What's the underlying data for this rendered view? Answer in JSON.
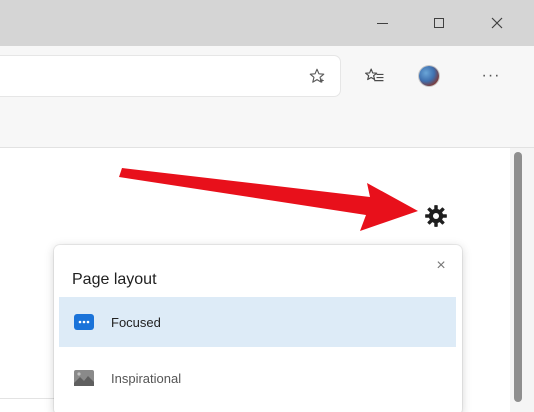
{
  "window": {
    "minimize_icon": "minimize-icon",
    "maximize_icon": "maximize-icon",
    "close_icon": "close-icon",
    "titlebar_color": "#d5d5d5"
  },
  "toolbar": {
    "favorite_star_icon": "star-icon",
    "favorites_hub_icon": "favorites-list-icon",
    "profile_icon": "avatar",
    "more_label": "···"
  },
  "page": {
    "settings_icon": "gear-icon",
    "annotation_arrow_color": "#e8101b"
  },
  "flyout": {
    "close_label": "×",
    "title": "Page layout",
    "options": [
      {
        "label": "Focused",
        "selected": true,
        "icon": "focused-layout-icon",
        "icon_color": "#1a73d9"
      },
      {
        "label": "Inspirational",
        "selected": false,
        "icon": "inspirational-layout-icon",
        "icon_color": "#8a8a8a"
      }
    ],
    "selected_bg": "#ddebf7"
  }
}
